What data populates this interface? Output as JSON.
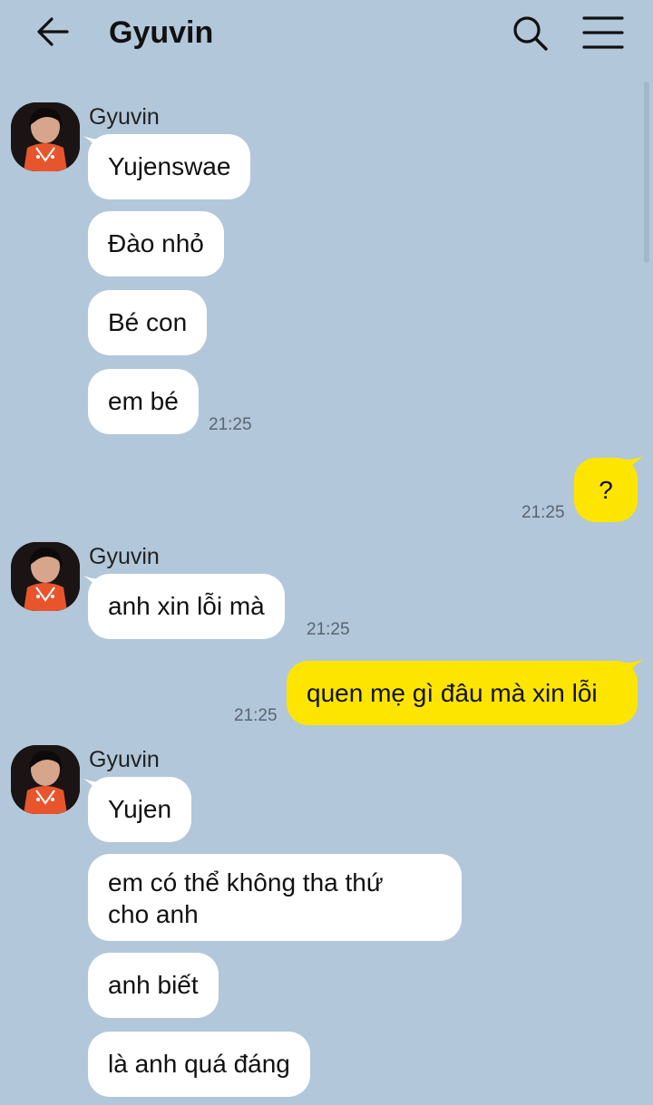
{
  "header": {
    "title": "Gyuvin",
    "back_icon": "back-arrow-icon",
    "search_icon": "search-icon",
    "menu_icon": "hamburger-menu-icon"
  },
  "colors": {
    "background": "#b2c7da",
    "incoming_bubble": "#ffffff",
    "outgoing_bubble": "#fee500"
  },
  "messages": {
    "g1": {
      "sender": "Gyuvin",
      "b1": "Yujenswae",
      "b2": "Đào nhỏ",
      "b3": "Bé con",
      "b4": "em bé",
      "time": "21:25"
    },
    "o1": {
      "text": "?",
      "time": "21:25"
    },
    "g2": {
      "sender": "Gyuvin",
      "b1": "anh xin lỗi mà",
      "time": "21:25"
    },
    "o2": {
      "text": "quen mẹ gì đâu mà xin lỗi",
      "time": "21:25"
    },
    "g3": {
      "sender": "Gyuvin",
      "b1": "Yujen",
      "b2": "em có thể không tha thứ\ncho anh",
      "b3": "anh biết",
      "b4": "là anh quá đáng"
    }
  }
}
